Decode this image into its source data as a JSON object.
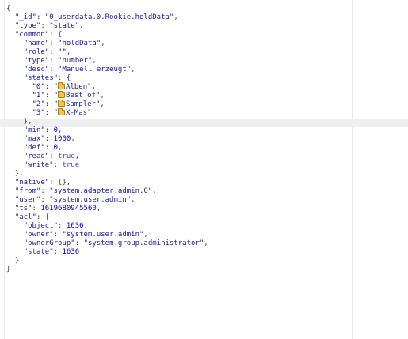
{
  "editor": {
    "lines": [
      [
        [
          "p",
          "{"
        ]
      ],
      [
        [
          "p",
          "  "
        ],
        [
          "k",
          "\"_id\""
        ],
        [
          "p",
          ": "
        ],
        [
          "s",
          "\"0_userdata.0.Rookie.holdData\""
        ],
        [
          "p",
          ","
        ]
      ],
      [
        [
          "p",
          "  "
        ],
        [
          "k",
          "\"type\""
        ],
        [
          "p",
          ": "
        ],
        [
          "s",
          "\"state\""
        ],
        [
          "p",
          ","
        ]
      ],
      [
        [
          "p",
          "  "
        ],
        [
          "k",
          "\"common\""
        ],
        [
          "p",
          ": {"
        ]
      ],
      [
        [
          "p",
          "    "
        ],
        [
          "k",
          "\"name\""
        ],
        [
          "p",
          ": "
        ],
        [
          "s",
          "\"holdData\""
        ],
        [
          "p",
          ","
        ]
      ],
      [
        [
          "p",
          "    "
        ],
        [
          "k",
          "\"role\""
        ],
        [
          "p",
          ": "
        ],
        [
          "s",
          "\"\""
        ],
        [
          "p",
          ","
        ]
      ],
      [
        [
          "p",
          "    "
        ],
        [
          "k",
          "\"type\""
        ],
        [
          "p",
          ": "
        ],
        [
          "s",
          "\"number\""
        ],
        [
          "p",
          ","
        ]
      ],
      [
        [
          "p",
          "    "
        ],
        [
          "k",
          "\"desc\""
        ],
        [
          "p",
          ": "
        ],
        [
          "s",
          "\"Manuell erzeugt\""
        ],
        [
          "p",
          ","
        ]
      ],
      [
        [
          "p",
          "    "
        ],
        [
          "k",
          "\"states\""
        ],
        [
          "p",
          ": {"
        ]
      ],
      [
        [
          "p",
          "      "
        ],
        [
          "k",
          "\"0\""
        ],
        [
          "p",
          ": "
        ],
        [
          "s",
          "\""
        ],
        [
          "i",
          "folder-icon"
        ],
        [
          "s",
          "Alben\""
        ],
        [
          "p",
          ","
        ]
      ],
      [
        [
          "p",
          "      "
        ],
        [
          "k",
          "\"1\""
        ],
        [
          "p",
          ": "
        ],
        [
          "s",
          "\""
        ],
        [
          "i",
          "folder-icon"
        ],
        [
          "s",
          "Best of\""
        ],
        [
          "p",
          ","
        ]
      ],
      [
        [
          "p",
          "      "
        ],
        [
          "k",
          "\"2\""
        ],
        [
          "p",
          ": "
        ],
        [
          "s",
          "\""
        ],
        [
          "i",
          "folder-icon"
        ],
        [
          "s",
          "Sampler\""
        ],
        [
          "p",
          ","
        ]
      ],
      [
        [
          "p",
          "      "
        ],
        [
          "k",
          "\"3\""
        ],
        [
          "p",
          ": "
        ],
        [
          "s",
          "\""
        ],
        [
          "i",
          "folder-icon"
        ],
        [
          "s",
          "X-Mas\""
        ]
      ],
      [
        [
          "p",
          "    },"
        ]
      ],
      [
        [
          "p",
          "    "
        ],
        [
          "k",
          "\"min\""
        ],
        [
          "p",
          ": "
        ],
        [
          "n",
          "0"
        ],
        [
          "p",
          ","
        ]
      ],
      [
        [
          "p",
          "    "
        ],
        [
          "k",
          "\"max\""
        ],
        [
          "p",
          ": "
        ],
        [
          "n",
          "1000"
        ],
        [
          "p",
          ","
        ]
      ],
      [
        [
          "p",
          "    "
        ],
        [
          "k",
          "\"def\""
        ],
        [
          "p",
          ": "
        ],
        [
          "n",
          "0"
        ],
        [
          "p",
          ","
        ]
      ],
      [
        [
          "p",
          "    "
        ],
        [
          "k",
          "\"read\""
        ],
        [
          "p",
          ": "
        ],
        [
          "b",
          "true"
        ],
        [
          "p",
          ","
        ]
      ],
      [
        [
          "p",
          "    "
        ],
        [
          "k",
          "\"write\""
        ],
        [
          "p",
          ": "
        ],
        [
          "b",
          "true"
        ]
      ],
      [
        [
          "p",
          "  },"
        ]
      ],
      [
        [
          "p",
          "  "
        ],
        [
          "k",
          "\"native\""
        ],
        [
          "p",
          ": {},"
        ]
      ],
      [
        [
          "p",
          "  "
        ],
        [
          "k",
          "\"from\""
        ],
        [
          "p",
          ": "
        ],
        [
          "s",
          "\"system.adapter.admin.0\""
        ],
        [
          "p",
          ","
        ]
      ],
      [
        [
          "p",
          "  "
        ],
        [
          "k",
          "\"user\""
        ],
        [
          "p",
          ": "
        ],
        [
          "s",
          "\"system.user.admin\""
        ],
        [
          "p",
          ","
        ]
      ],
      [
        [
          "p",
          "  "
        ],
        [
          "k",
          "\"ts\""
        ],
        [
          "p",
          ": "
        ],
        [
          "n",
          "1619680945560"
        ],
        [
          "p",
          ","
        ]
      ],
      [
        [
          "p",
          "  "
        ],
        [
          "k",
          "\"acl\""
        ],
        [
          "p",
          ": {"
        ]
      ],
      [
        [
          "p",
          "    "
        ],
        [
          "k",
          "\"object\""
        ],
        [
          "p",
          ": "
        ],
        [
          "n",
          "1636"
        ],
        [
          "p",
          ","
        ]
      ],
      [
        [
          "p",
          "    "
        ],
        [
          "k",
          "\"owner\""
        ],
        [
          "p",
          ": "
        ],
        [
          "s",
          "\"system.user.admin\""
        ],
        [
          "p",
          ","
        ]
      ],
      [
        [
          "p",
          "    "
        ],
        [
          "k",
          "\"ownerGroup\""
        ],
        [
          "p",
          ": "
        ],
        [
          "s",
          "\"system.group.administrator\""
        ],
        [
          "p",
          ","
        ]
      ],
      [
        [
          "p",
          "    "
        ],
        [
          "k",
          "\"state\""
        ],
        [
          "p",
          ": "
        ],
        [
          "n",
          "1636"
        ]
      ],
      [
        [
          "p",
          "  }"
        ]
      ],
      [
        [
          "p",
          "}"
        ]
      ]
    ]
  }
}
